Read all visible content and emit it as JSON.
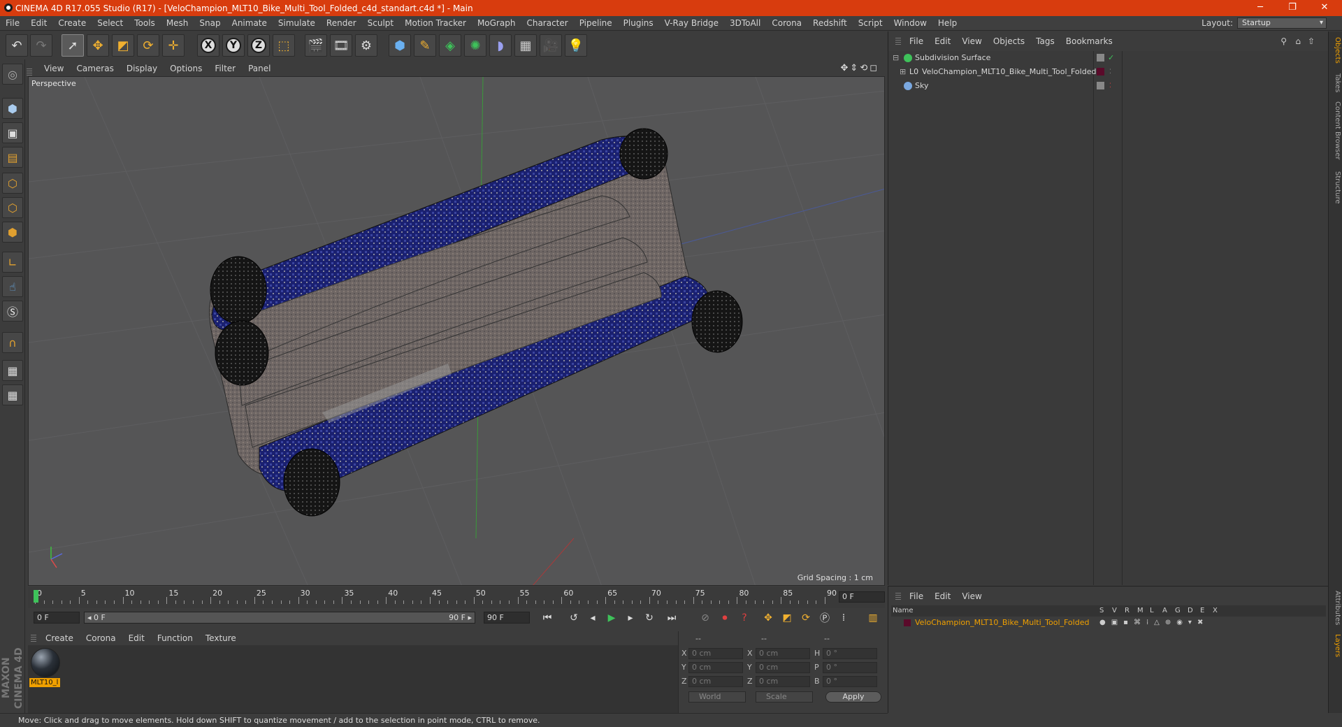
{
  "title_bar": {
    "title": "CINEMA 4D R17.055 Studio (R17) - [VeloChampion_MLT10_Bike_Multi_Tool_Folded_c4d_standart.c4d *] - Main",
    "minimize": "─",
    "restore": "❐",
    "close": "✕"
  },
  "menu": [
    "File",
    "Edit",
    "Create",
    "Select",
    "Tools",
    "Mesh",
    "Snap",
    "Animate",
    "Simulate",
    "Render",
    "Sculpt",
    "Motion Tracker",
    "MoGraph",
    "Character",
    "Pipeline",
    "Plugins",
    "V-Ray Bridge",
    "3DToAll",
    "Corona",
    "Redshift",
    "Script",
    "Window",
    "Help"
  ],
  "layout": {
    "label": "Layout:",
    "value": "Startup"
  },
  "toolbar": {
    "axis_x": "X",
    "axis_y": "Y",
    "axis_z": "Z"
  },
  "viewport": {
    "menu": [
      "View",
      "Cameras",
      "Display",
      "Options",
      "Filter",
      "Panel"
    ],
    "camera_label": "Perspective",
    "grid_spacing": "Grid Spacing : 1 cm",
    "nav_icons": "✥⇕⟲◻"
  },
  "timeline": {
    "ticks": [
      "0",
      "5",
      "10",
      "15",
      "20",
      "25",
      "30",
      "35",
      "40",
      "45",
      "50",
      "55",
      "60",
      "65",
      "70",
      "75",
      "80",
      "85",
      "90"
    ],
    "frame_display": "0 F",
    "start_field": "0 F",
    "range_start": "◂ 0 F",
    "range_end": "90 F ▸",
    "end_field": "90 F"
  },
  "materials": {
    "menu": [
      "Create",
      "Corona",
      "Edit",
      "Function",
      "Texture"
    ],
    "items": [
      {
        "name": "MLT10_l"
      }
    ]
  },
  "coordinates": {
    "header": [
      "--",
      "--",
      "--"
    ],
    "rows": [
      {
        "axis1": "X",
        "val1": "0 cm",
        "axis2": "X",
        "val2": "0 cm",
        "axis3": "H",
        "val3": "0 °"
      },
      {
        "axis1": "Y",
        "val1": "0 cm",
        "axis2": "Y",
        "val2": "0 cm",
        "axis3": "P",
        "val3": "0 °"
      },
      {
        "axis1": "Z",
        "val1": "0 cm",
        "axis2": "Z",
        "val2": "0 cm",
        "axis3": "B",
        "val3": "0 °"
      }
    ],
    "mode1": "World",
    "mode2": "Scale",
    "apply": "Apply"
  },
  "status": "Move: Click and drag to move elements. Hold down SHIFT to quantize movement / add to the selection in point mode, CTRL to remove.",
  "object_manager": {
    "menu": [
      "File",
      "Edit",
      "View",
      "Objects",
      "Tags",
      "Bookmarks"
    ],
    "objects": [
      {
        "name": "Subdivision Surface",
        "icon_color": "#3ec25a"
      },
      {
        "name": "VeloChampion_MLT10_Bike_Multi_Tool_Folded",
        "icon_color": "#d8d8d8"
      },
      {
        "name": "Sky",
        "icon_color": "#7aa8e0"
      }
    ]
  },
  "layers_manager": {
    "menu": [
      "File",
      "Edit",
      "View"
    ],
    "columns": [
      "Name",
      "S",
      "V",
      "R",
      "M",
      "L",
      "A",
      "G",
      "D",
      "E",
      "X"
    ],
    "layer": {
      "name": "VeloChampion_MLT10_Bike_Multi_Tool_Folded",
      "color": "#7a1030"
    }
  },
  "side_tabs": [
    "Objects",
    "Takes",
    "Content Browser",
    "Structure",
    "Attributes",
    "Layers"
  ],
  "maxon_logo": "MAXON CINEMA 4D",
  "colors": {
    "title_bar": "#d83c0e",
    "accent_orange": "#f0a000",
    "viewport_bg": "#555556",
    "tool_blue": "#1f2a7a"
  }
}
